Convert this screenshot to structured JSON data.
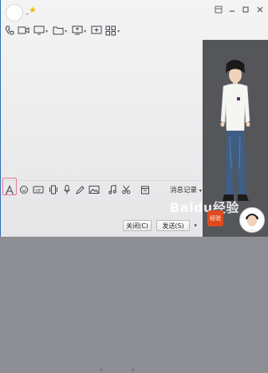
{
  "window": {
    "contact_name": "_",
    "accent": "#2b6cb0",
    "controls": [
      "pin-icon",
      "minimize-icon",
      "maximize-icon",
      "close-icon"
    ]
  },
  "top_toolbar": {
    "icons": [
      "phone-icon",
      "video-call-icon",
      "screen-share-icon",
      "file-transfer-icon",
      "remote-desktop-icon",
      "app-center-icon",
      "more-apps-icon"
    ]
  },
  "input_toolbar": {
    "icons": [
      "font-icon",
      "emoji-icon",
      "gif-icon",
      "shake-icon",
      "voice-icon",
      "doodle-icon",
      "image-icon",
      "music-icon",
      "screenshot-icon",
      "history-icon"
    ],
    "history_label": "消息记录"
  },
  "actions": {
    "close_label": "关闭(C)",
    "send_label": "发送(S)"
  },
  "show_panel": {
    "watermark": "Baidu经验",
    "badge_text": "经验"
  }
}
